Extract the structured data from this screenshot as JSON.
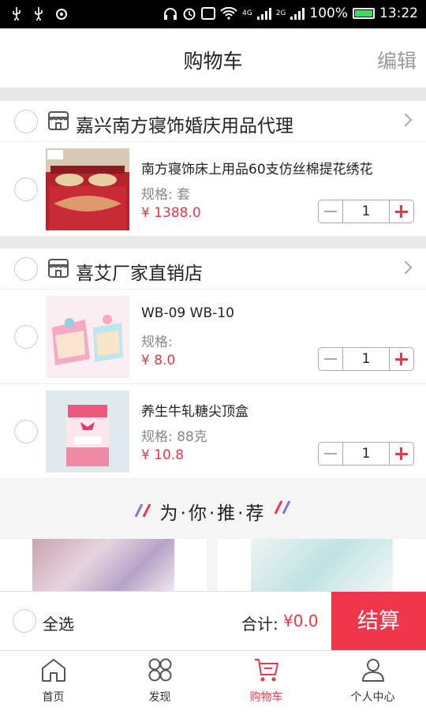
{
  "status_bar": {
    "network_4g": "4G",
    "network_2g": "2G",
    "battery": "100%",
    "time": "13:22"
  },
  "header": {
    "title": "购物车",
    "edit": "编辑"
  },
  "stores": [
    {
      "name": "嘉兴南方寝饰婚庆用品代理",
      "items": [
        {
          "name": "南方寝饰床上用品60支仿丝棉提花绣花",
          "spec": "规格: 套",
          "price": "¥ 1388.0",
          "qty": "1"
        }
      ]
    },
    {
      "name": "喜艾厂家直销店",
      "items": [
        {
          "name": "WB-09 WB-10",
          "spec": "规格:",
          "price": "¥ 8.0",
          "qty": "1"
        },
        {
          "name": "养生牛轧糖尖顶盒",
          "spec": "规格: 88克",
          "price": "¥ 10.8",
          "qty": "1"
        }
      ]
    }
  ],
  "recommend": {
    "title": "为·你·推·荐"
  },
  "checkout": {
    "select_all": "全选",
    "total_label": "合计:",
    "total_value": "¥0.0",
    "button": "结算"
  },
  "tabs": [
    {
      "label": "首页",
      "icon": "home-icon"
    },
    {
      "label": "发现",
      "icon": "discover-icon"
    },
    {
      "label": "购物车",
      "icon": "cart-icon",
      "active": true
    },
    {
      "label": "个人中心",
      "icon": "user-icon"
    }
  ],
  "colors": {
    "accent": "#e8364a",
    "checkout_button": "#f0364a",
    "battery": "#3ddc5c"
  }
}
